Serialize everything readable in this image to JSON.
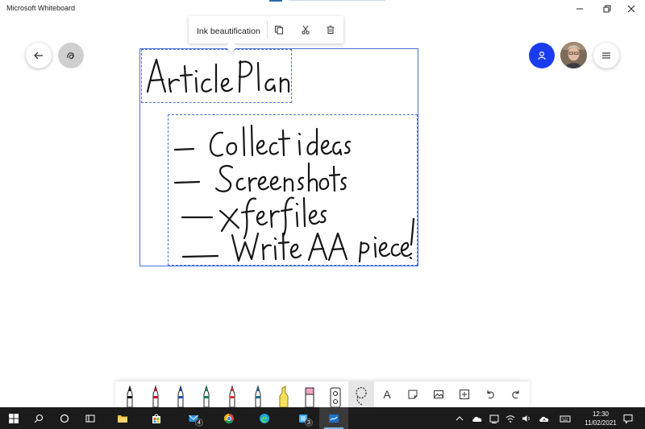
{
  "window": {
    "title": "Microsoft Whiteboard"
  },
  "context_menu": {
    "label": "Ink beautification"
  },
  "taskbar": {
    "mail_badge": "4",
    "files_badge": "3",
    "time": "12:30",
    "date": "11/02/2021"
  },
  "colors": {
    "accent": "#1a3cf0",
    "selection": "#4a6fd6",
    "taskbar": "#1b1b1b",
    "ink": "#151515"
  },
  "pens": [
    {
      "name": "pen-black",
      "color": "#1a1a1a"
    },
    {
      "name": "pen-red",
      "color": "#c8102e"
    },
    {
      "name": "pen-blue",
      "color": "#1f4fb4"
    },
    {
      "name": "pen-green",
      "color": "#0b8a55"
    },
    {
      "name": "pen-red-2",
      "color": "#d43a3a"
    },
    {
      "name": "pen-teal",
      "color": "#1f6f8b"
    }
  ]
}
